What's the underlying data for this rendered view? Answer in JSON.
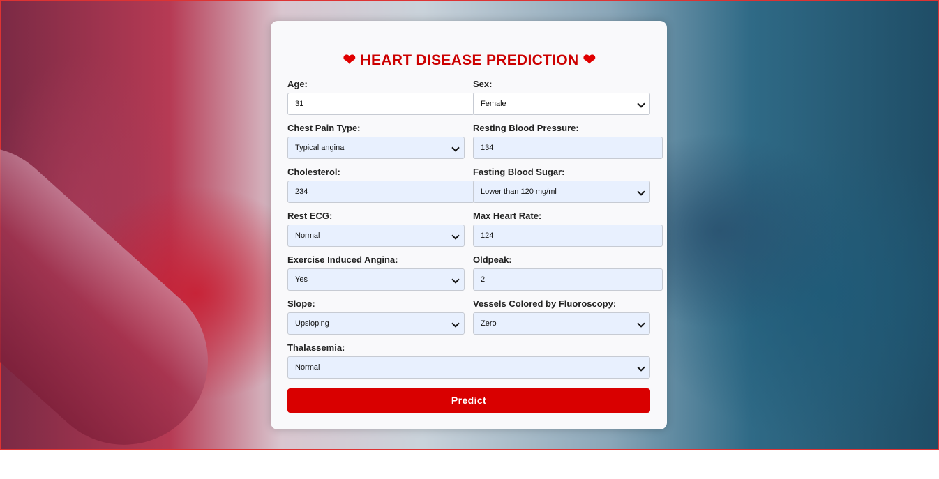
{
  "title": "HEART DISEASE PREDICTION",
  "heart_icon": "❤",
  "fields": {
    "age": {
      "label": "Age:",
      "value": "31"
    },
    "sex": {
      "label": "Sex:",
      "value": "Female"
    },
    "chest_pain": {
      "label": "Chest Pain Type:",
      "value": "Typical angina"
    },
    "resting_bp": {
      "label": "Resting Blood Pressure:",
      "value": "134"
    },
    "cholesterol": {
      "label": "Cholesterol:",
      "value": "234"
    },
    "fasting_bs": {
      "label": "Fasting Blood Sugar:",
      "value": "Lower than 120 mg/ml"
    },
    "rest_ecg": {
      "label": "Rest ECG:",
      "value": "Normal"
    },
    "max_hr": {
      "label": "Max Heart Rate:",
      "value": "124"
    },
    "exercise_angina": {
      "label": "Exercise Induced Angina:",
      "value": "Yes"
    },
    "oldpeak": {
      "label": "Oldpeak:",
      "value": "2"
    },
    "slope": {
      "label": "Slope:",
      "value": "Upsloping"
    },
    "vessels": {
      "label": "Vessels Colored by Fluoroscopy:",
      "value": "Zero"
    },
    "thalassemia": {
      "label": "Thalassemia:",
      "value": "Normal"
    }
  },
  "predict_label": "Predict",
  "colors": {
    "accent": "#d90000",
    "title": "#cc0000",
    "input_bg": "#e8f0fe"
  }
}
